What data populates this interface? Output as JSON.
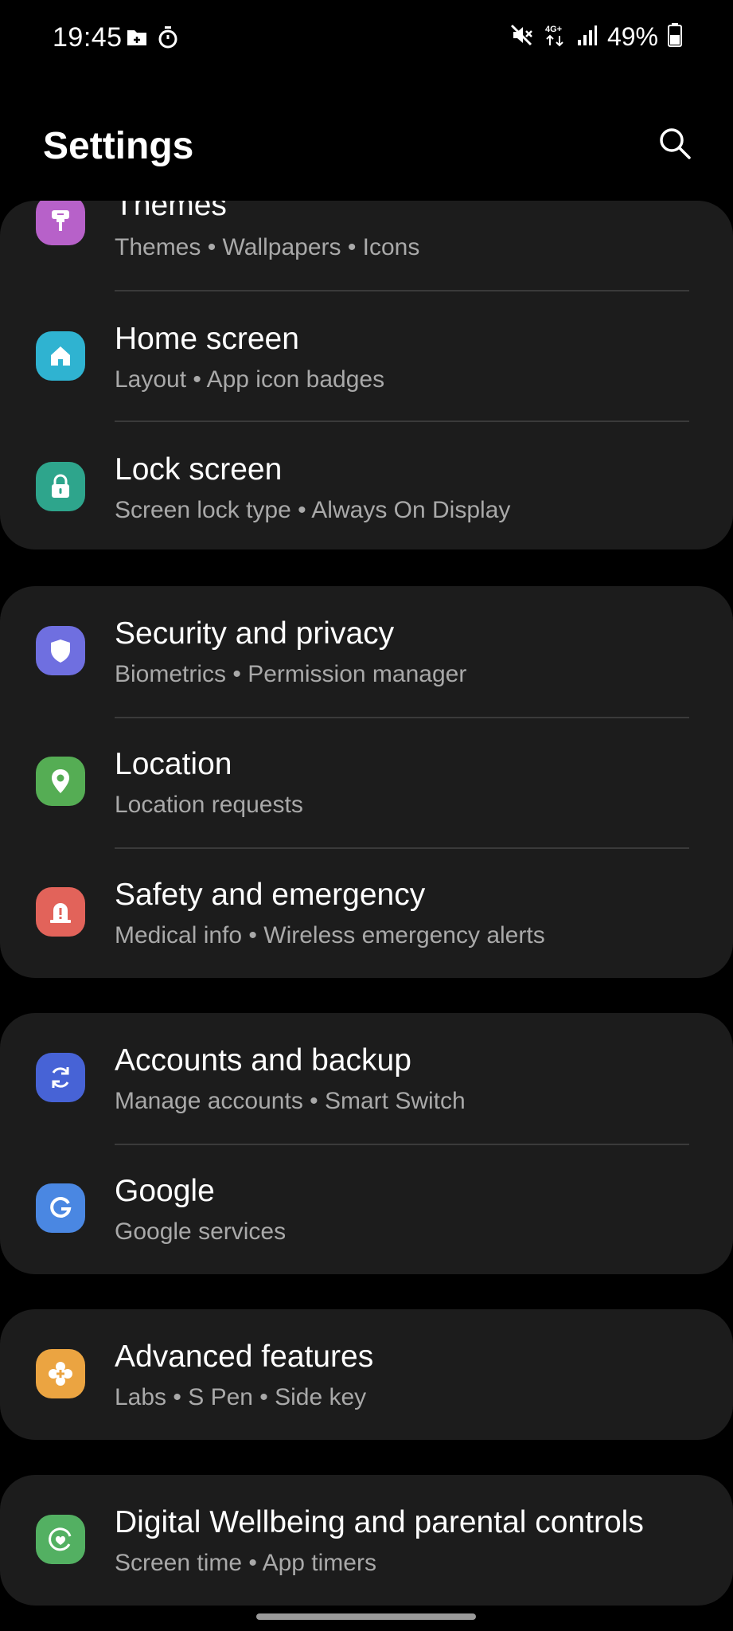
{
  "status_bar": {
    "time": "19:45",
    "battery": "49%",
    "network": "4G+",
    "icons": [
      "folder-icon",
      "timer-icon",
      "mute-icon",
      "network-icon",
      "signal-icon",
      "battery-icon"
    ]
  },
  "header": {
    "title": "Settings",
    "search_icon": "search-icon"
  },
  "groups": [
    {
      "items": [
        {
          "title": "Themes",
          "subtitle": "Themes  •  Wallpapers  •  Icons",
          "icon": "brush-icon",
          "color": "#b761c9"
        },
        {
          "title": "Home screen",
          "subtitle": "Layout  •  App icon badges",
          "icon": "home-icon",
          "color": "#2fb3d1"
        },
        {
          "title": "Lock screen",
          "subtitle": "Screen lock type  •  Always On Display",
          "icon": "lock-icon",
          "color": "#2ea58c"
        }
      ]
    },
    {
      "items": [
        {
          "title": "Security and privacy",
          "subtitle": "Biometrics  •  Permission manager",
          "icon": "shield-icon",
          "color": "#6f6fe0"
        },
        {
          "title": "Location",
          "subtitle": "Location requests",
          "icon": "location-pin-icon",
          "color": "#55ad54"
        },
        {
          "title": "Safety and emergency",
          "subtitle": "Medical info  •  Wireless emergency alerts",
          "icon": "alert-icon",
          "color": "#e2635a"
        }
      ]
    },
    {
      "items": [
        {
          "title": "Accounts and backup",
          "subtitle": "Manage accounts  •  Smart Switch",
          "icon": "sync-icon",
          "color": "#4763d6"
        },
        {
          "title": "Google",
          "subtitle": "Google services",
          "icon": "google-icon",
          "color": "#4a87e2"
        }
      ]
    },
    {
      "items": [
        {
          "title": "Advanced features",
          "subtitle": "Labs  •  S Pen  •  Side key",
          "icon": "gear-plus-icon",
          "color": "#eba441"
        }
      ]
    },
    {
      "items": [
        {
          "title": "Digital Wellbeing and parental controls",
          "subtitle": "Screen time  •  App timers",
          "icon": "wellbeing-icon",
          "color": "#53b062"
        }
      ]
    }
  ]
}
